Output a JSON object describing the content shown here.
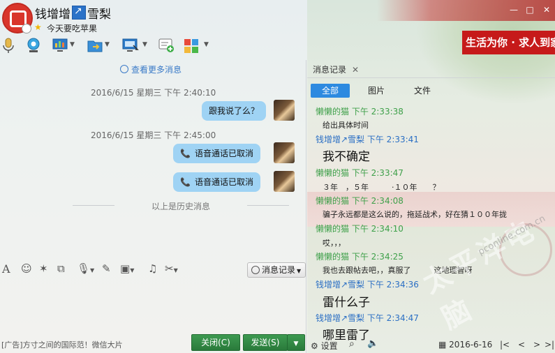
{
  "window": {
    "contact_name": "钱增增",
    "contact_alias": "雪梨",
    "signature": "今天要吃苹果",
    "controls": [
      "—",
      "□",
      "✕"
    ],
    "ad_banner": "生活为你 · 求人到家"
  },
  "toolbar": {
    "icons": [
      "voice-call-icon",
      "video-call-icon",
      "screen-share-icon",
      "file-transfer-icon",
      "remote-desktop-icon",
      "add-app-icon",
      "apps-icon"
    ]
  },
  "chat": {
    "view_more": "查看更多消息",
    "messages": [
      {
        "time": "2016/6/15 星期三 下午 2:40:10",
        "text": "跟我说了么？",
        "type": "text"
      },
      {
        "time": "2016/6/15 星期三 下午 2:45:00",
        "text": "语音通话已取消",
        "type": "call"
      },
      {
        "time": "",
        "text": "语音通话已取消",
        "type": "call"
      }
    ],
    "history_divider": "以上是历史消息"
  },
  "input_toolbar": {
    "icons": [
      "font-icon",
      "emoji-icon",
      "vibrate-icon",
      "gif-icon",
      "voice-message-icon",
      "handwrite-icon",
      "image-icon",
      "music-icon",
      "screenshot-icon"
    ],
    "history_button": "消息记录"
  },
  "footer": {
    "ad_text": "[广告]方寸之间的国际范！微信大片",
    "close_label": "关闭(C)",
    "send_label": "发送(S)"
  },
  "history_panel": {
    "tab_label": "消息记录",
    "filters": [
      "全部",
      "图片",
      "文件"
    ],
    "entries": [
      {
        "sender": "懒懒的猫 下午 2:33:38",
        "side": "other",
        "text": "给出具体时间",
        "size": "small"
      },
      {
        "sender": "钱增增↗雪梨 下午 2:33:41",
        "side": "me",
        "text": "我不确定",
        "size": "large"
      },
      {
        "sender": "懒懒的猫 下午 2:33:47",
        "side": "other",
        "text": "３年　，５年　　　·１０年　　？",
        "size": "small"
      },
      {
        "sender": "懒懒的猫 下午 2:34:08",
        "side": "other",
        "text": "骗子永远都是这么说的，拖延战术，好在猜１００年拢",
        "size": "small"
      },
      {
        "sender": "懒懒的猫 下午 2:34:10",
        "side": "other",
        "text": "哎，，，",
        "size": "small"
      },
      {
        "sender": "懒懒的猫 下午 2:34:25",
        "side": "other",
        "text": "我也去跟帖去吧，，真服了　　　这地理智呀",
        "size": "small"
      },
      {
        "sender": "钱增增↗雪梨 下午 2:34:36",
        "side": "me",
        "text": "雷什么子",
        "size": "large"
      },
      {
        "sender": "钱增增↗雪梨 下午 2:34:47",
        "side": "me",
        "text": "哪里雷了",
        "size": "large"
      }
    ],
    "settings_label": "设置",
    "date": "2016-6-16",
    "nav": [
      "|<",
      "<",
      ">",
      ">|"
    ]
  },
  "watermark": {
    "text": "太平洋电脑",
    "url": "pconline.com.cn"
  }
}
